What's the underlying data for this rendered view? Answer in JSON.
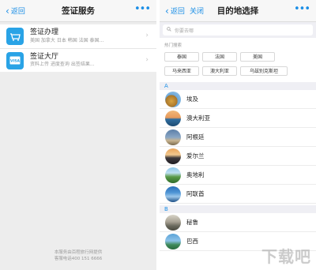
{
  "left": {
    "nav": {
      "back_label": "返回",
      "title": "签证服务",
      "more": "•••"
    },
    "items": [
      {
        "title": "签证办理",
        "subtitle": "美国 加拿大 日本 韩国 法国 泰国...",
        "icon": "visa-passport-icon"
      },
      {
        "title": "签证大厅",
        "subtitle": "资料上传 进度查询 出签结果...",
        "icon": "visa-card-icon"
      }
    ],
    "footer": {
      "line1": "本服务由百程旅行网提供",
      "line2": "客服电话400 151 6666"
    }
  },
  "right": {
    "nav": {
      "back_label": "返回",
      "close_label": "关闭",
      "title": "目的地选择",
      "more": "•••"
    },
    "search": {
      "placeholder": "你要去哪"
    },
    "hot_label": "热门搜索",
    "hot": [
      "泰国",
      "法国",
      "美国",
      "马来西亚",
      "澳大利亚",
      "乌兹别克斯坦"
    ],
    "sections": [
      {
        "letter": "A",
        "items": [
          "埃及",
          "澳大利亚",
          "阿根廷",
          "爱尔兰",
          "奥地利",
          "阿联酋"
        ]
      },
      {
        "letter": "B",
        "items": [
          "秘鲁",
          "巴西"
        ]
      }
    ],
    "watermark": "下载吧"
  },
  "colors": {
    "accent": "#1a8ee6",
    "icon_bg": "#29a3e6"
  }
}
